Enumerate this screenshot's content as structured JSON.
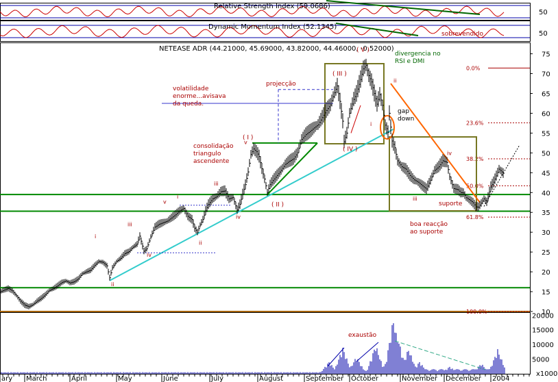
{
  "chart_data": {
    "type": "ohlc",
    "title": "NETEASE ADR (44.21000, 45.69000, 43.82000, 44.46000, -0.52000)",
    "months": [
      "ary",
      "March",
      "April",
      "May",
      "June",
      "July",
      "August",
      "September",
      "October",
      "November",
      "December",
      "2004"
    ],
    "price_axis": {
      "ticks": [
        10,
        15,
        20,
        25,
        30,
        35,
        40,
        45,
        50,
        55,
        60,
        65,
        70,
        75
      ],
      "range": [
        10,
        77
      ]
    },
    "volume_axis": {
      "ticks": [
        "20000",
        "15000",
        "10000",
        "5000"
      ],
      "unit": "x1000",
      "range": [
        0,
        21000
      ]
    },
    "rsi": {
      "label": "Relative Strength Index (59.0686)",
      "tick": "50"
    },
    "dmi": {
      "label": "Dynamic Momentum Index (52.1345)",
      "tick": "50",
      "note": "sobrevendido"
    },
    "price_series": [
      [
        0,
        14.9
      ],
      [
        6,
        15.4
      ],
      [
        12,
        15.8
      ],
      [
        18,
        15.2
      ],
      [
        24,
        14.0
      ],
      [
        30,
        12.6
      ],
      [
        36,
        11.6
      ],
      [
        42,
        11.2
      ],
      [
        48,
        11.7
      ],
      [
        54,
        12.6
      ],
      [
        60,
        13.3
      ],
      [
        66,
        14.2
      ],
      [
        72,
        15.3
      ],
      [
        78,
        15.8
      ],
      [
        84,
        16.5
      ],
      [
        90,
        17.3
      ],
      [
        96,
        17.7
      ],
      [
        102,
        17.2
      ],
      [
        108,
        17.5
      ],
      [
        114,
        18.2
      ],
      [
        120,
        19.5
      ],
      [
        126,
        20.0
      ],
      [
        132,
        20.4
      ],
      [
        138,
        21.6
      ],
      [
        144,
        22.6
      ],
      [
        150,
        22.4
      ],
      [
        156,
        21.5
      ],
      [
        160,
        18.5
      ],
      [
        164,
        21.0
      ],
      [
        170,
        22.6
      ],
      [
        176,
        23.4
      ],
      [
        182,
        24.6
      ],
      [
        188,
        25.1
      ],
      [
        194,
        26.2
      ],
      [
        200,
        27.0
      ],
      [
        204,
        29.0
      ],
      [
        210,
        25.2
      ],
      [
        214,
        25.8
      ],
      [
        220,
        28.8
      ],
      [
        226,
        31.3
      ],
      [
        232,
        32.0
      ],
      [
        238,
        32.4
      ],
      [
        244,
        32.8
      ],
      [
        250,
        33.6
      ],
      [
        256,
        34.4
      ],
      [
        262,
        35.4
      ],
      [
        268,
        36.0
      ],
      [
        274,
        34.0
      ],
      [
        280,
        33.2
      ],
      [
        284,
        31.0
      ],
      [
        288,
        30.0
      ],
      [
        292,
        31.8
      ],
      [
        296,
        33.2
      ],
      [
        300,
        35.4
      ],
      [
        304,
        37.0
      ],
      [
        310,
        38.4
      ],
      [
        316,
        39.0
      ],
      [
        322,
        40.2
      ],
      [
        328,
        40.4
      ],
      [
        334,
        38.4
      ],
      [
        340,
        38.8
      ],
      [
        346,
        35.6
      ],
      [
        350,
        37.0
      ],
      [
        354,
        39.6
      ],
      [
        358,
        42.0
      ],
      [
        362,
        45.2
      ],
      [
        366,
        49.6
      ],
      [
        370,
        51.0
      ],
      [
        374,
        50.3
      ],
      [
        378,
        49.1
      ],
      [
        382,
        46.0
      ],
      [
        386,
        43.4
      ],
      [
        390,
        40.0
      ],
      [
        394,
        42.0
      ],
      [
        398,
        43.0
      ],
      [
        404,
        44.3
      ],
      [
        410,
        45.6
      ],
      [
        416,
        47.1
      ],
      [
        422,
        47.9
      ],
      [
        428,
        48.5
      ],
      [
        434,
        50.0
      ],
      [
        440,
        53.4
      ],
      [
        446,
        54.6
      ],
      [
        452,
        55.4
      ],
      [
        458,
        56.3
      ],
      [
        464,
        57.1
      ],
      [
        470,
        58.9
      ],
      [
        476,
        60.7
      ],
      [
        482,
        62.1
      ],
      [
        488,
        65.2
      ],
      [
        492,
        66.9
      ],
      [
        496,
        63.0
      ],
      [
        500,
        58.0
      ],
      [
        502,
        52.8
      ],
      [
        506,
        55.0
      ],
      [
        510,
        60.0
      ],
      [
        516,
        63.5
      ],
      [
        520,
        64.9
      ],
      [
        526,
        68.5
      ],
      [
        530,
        71.2
      ],
      [
        534,
        72.1
      ],
      [
        538,
        69.5
      ],
      [
        542,
        67.9
      ],
      [
        546,
        65.0
      ],
      [
        550,
        62.3
      ],
      [
        554,
        64.7
      ],
      [
        558,
        62.0
      ],
      [
        562,
        57.0
      ],
      [
        566,
        55.2
      ],
      [
        568,
        60.0
      ],
      [
        572,
        53.0
      ],
      [
        576,
        51.3
      ],
      [
        580,
        48.0
      ],
      [
        586,
        46.5
      ],
      [
        592,
        45.9
      ],
      [
        598,
        44.3
      ],
      [
        604,
        43.2
      ],
      [
        610,
        42.6
      ],
      [
        616,
        41.7
      ],
      [
        622,
        40.9
      ],
      [
        628,
        43.1
      ],
      [
        634,
        45.6
      ],
      [
        640,
        46.5
      ],
      [
        646,
        48.0
      ],
      [
        652,
        47.6
      ],
      [
        656,
        44.0
      ],
      [
        662,
        41.0
      ],
      [
        668,
        40.7
      ],
      [
        672,
        40.0
      ],
      [
        676,
        39.9
      ],
      [
        680,
        38.7
      ],
      [
        686,
        38.0
      ],
      [
        690,
        37.4
      ],
      [
        694,
        36.4
      ],
      [
        698,
        36.3
      ],
      [
        702,
        37.3
      ],
      [
        706,
        38.4
      ],
      [
        710,
        37.6
      ],
      [
        716,
        41.4
      ],
      [
        720,
        42.6
      ],
      [
        724,
        44.2
      ],
      [
        728,
        45.9
      ],
      [
        732,
        45.2
      ],
      [
        736,
        44.5
      ]
    ],
    "volume_peaks": [
      [
        480,
        4200
      ],
      [
        500,
        9200
      ],
      [
        520,
        6000
      ],
      [
        548,
        10200
      ],
      [
        566,
        4800
      ],
      [
        574,
        19500
      ],
      [
        580,
        13200
      ],
      [
        596,
        8800
      ],
      [
        612,
        4200
      ],
      [
        656,
        2500
      ],
      [
        702,
        3600
      ],
      [
        726,
        8500
      ]
    ],
    "horizontal_levels": [
      16.0,
      35.3,
      39.5
    ],
    "fibonacci": [
      {
        "label": "0.0%",
        "value": 71.4
      },
      {
        "label": "23.6%",
        "value": 57.6
      },
      {
        "label": "38.2%",
        "value": 48.5
      },
      {
        "label": "50.0%",
        "value": 41.7
      },
      {
        "label": "61.8%",
        "value": 33.8
      },
      {
        "label": "100.0%",
        "value": 10.0
      }
    ],
    "annotations": {
      "volatilidade": [
        "volatilidade",
        "enorme...avisava",
        "da queda."
      ],
      "projeccao": "projecção",
      "consolidacao": [
        "consolidação",
        "triangulo",
        "ascendente"
      ],
      "divergencia": [
        "divergencia no",
        "RSI e DMI"
      ],
      "gap": [
        "gap",
        "down"
      ],
      "exaustao": "exaustão",
      "suporte": "suporte",
      "boa_reaccao": [
        "boa reacção",
        "ao suporte"
      ],
      "waves_primary": [
        "( I )",
        "( II )",
        "( III )",
        "( IV )",
        "( V )"
      ],
      "waves_minor": [
        "i",
        "ii",
        "iii",
        "iv",
        "v"
      ]
    }
  }
}
